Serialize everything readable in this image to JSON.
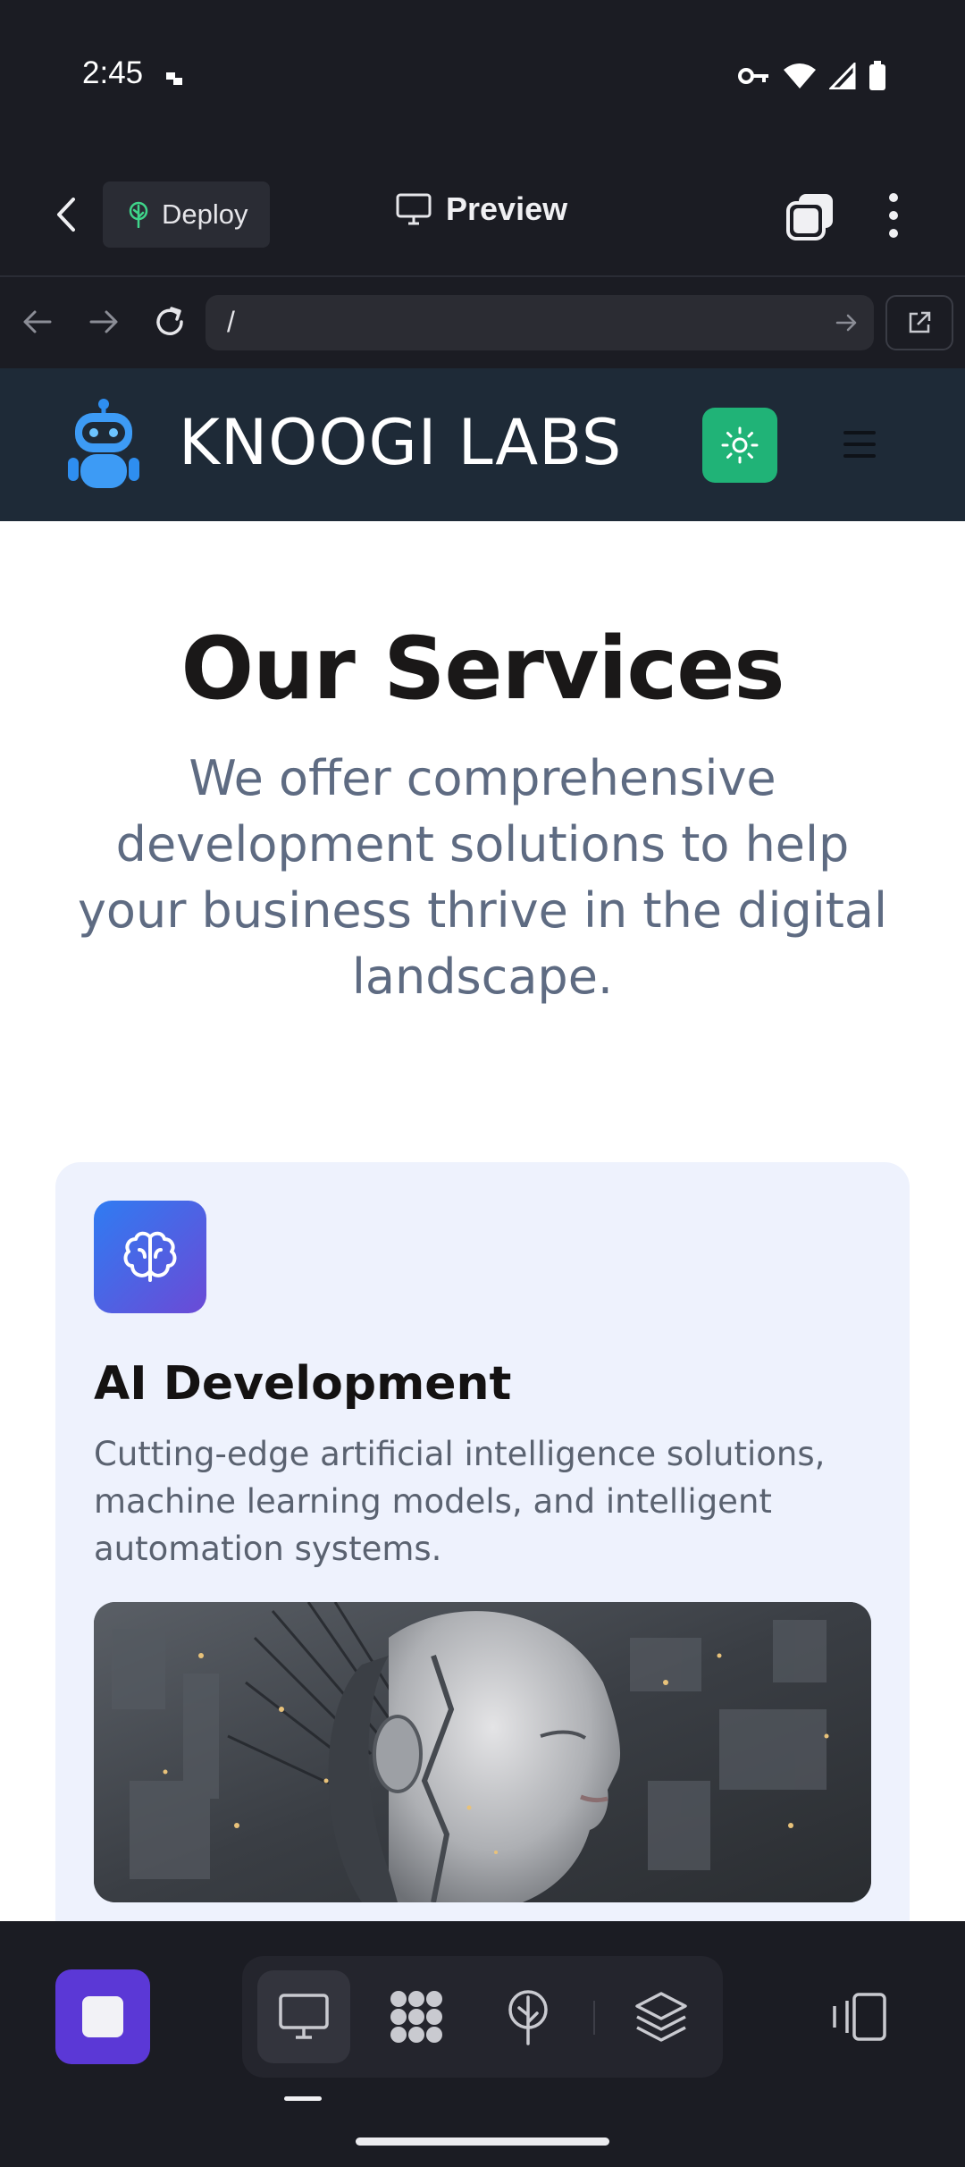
{
  "status_bar": {
    "time": "2:45",
    "icons": [
      "notification-dot-icon",
      "vpn-key-icon",
      "wifi-icon",
      "signal-icon",
      "battery-icon"
    ]
  },
  "toolbar": {
    "back_icon": "chevron-left-icon",
    "deploy_label": "Deploy",
    "deploy_icon": "tree-icon",
    "preview_label": "Preview",
    "preview_icon": "monitor-icon",
    "tabs_icon": "tabs-icon",
    "more_icon": "more-vertical-icon"
  },
  "url_bar": {
    "url": "/",
    "icons": [
      "arrow-left-icon",
      "arrow-right-icon",
      "refresh-icon",
      "go-arrow-icon",
      "external-link-icon"
    ]
  },
  "site": {
    "brand": "KNOOGI LABS",
    "logo_icon": "robot-icon",
    "theme_icon": "sun-icon",
    "menu_icon": "hamburger-menu-icon",
    "services_title": "Our Services",
    "services_subtitle": "We offer comprehensive development solutions to help your business thrive in the digital landscape.",
    "card": {
      "icon": "brain-icon",
      "title": "AI Development",
      "description": "Cutting-edge artificial intelligence solutions, machine learning models, and intelligent automation systems."
    }
  },
  "bottom_bar": {
    "tools": [
      "monitor-icon",
      "apps-icon",
      "deploy-tree-icon",
      "layers-icon"
    ],
    "active_tool": "monitor-icon"
  },
  "colors": {
    "app_bg": "#1b1c23",
    "site_header_bg": "#1e2a37",
    "theme_button": "#20b377",
    "accent_purple": "#5b38d6",
    "card_bg": "#eef2fd",
    "subtitle_text": "#5e6b82"
  }
}
